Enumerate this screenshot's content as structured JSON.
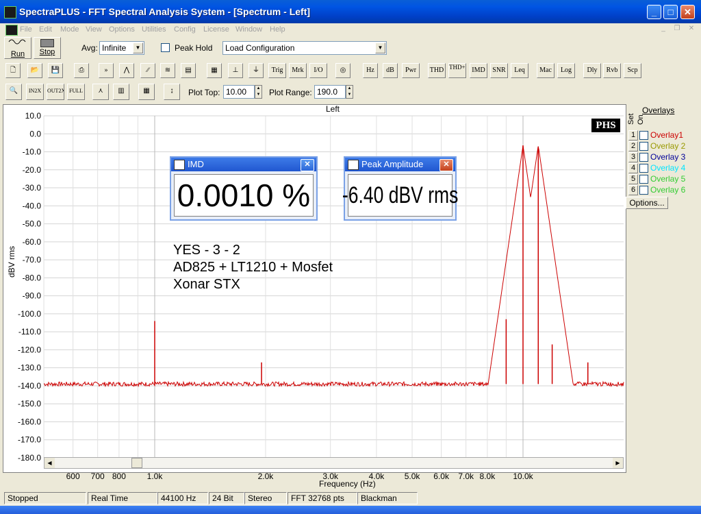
{
  "window": {
    "title": "SpectraPLUS - FFT Spectral Analysis System - [Spectrum - Left]"
  },
  "menu": [
    "File",
    "Edit",
    "Mode",
    "View",
    "Options",
    "Utilities",
    "Config",
    "License",
    "Window",
    "Help"
  ],
  "toolbar1": {
    "run": "Run",
    "stop": "Stop",
    "avg_label": "Avg:",
    "avg_value": "Infinite",
    "peak_hold": "Peak Hold",
    "config_value": "Load Configuration"
  },
  "toolbar2": [
    "Trig",
    "Mrk",
    "I/O",
    "Hz",
    "dB",
    "Pwr",
    "THD",
    "THD+N",
    "IMD",
    "SNR",
    "Leq",
    "Mac",
    "Log",
    "Dly",
    "Rvb",
    "Scp"
  ],
  "toolbar3": {
    "plot_top_label": "Plot Top:",
    "plot_top": "10.00",
    "plot_range_label": "Plot Range:",
    "plot_range": "190.0"
  },
  "plot": {
    "channel": "Left",
    "logo": "PHS",
    "ylabel": "dBV rms",
    "xlabel": "Frequency (Hz)",
    "annotation": [
      "YES - 3 - 2",
      "AD825 + LT1210 + Mosfet",
      "Xonar STX"
    ]
  },
  "chart_data": {
    "type": "line",
    "title": "Left",
    "xlabel": "Frequency (Hz)",
    "ylabel": "dBV rms",
    "x_scale": "log",
    "xlim": [
      500,
      20000
    ],
    "ylim": [
      -180,
      10
    ],
    "x_ticks": [
      "600",
      "700",
      "800",
      "1.0k",
      "2.0k",
      "3.0k",
      "4.0k",
      "5.0k",
      "6.0k",
      "7.0k",
      "8.0k",
      "10.0k"
    ],
    "y_ticks": [
      "10.0",
      "0.0",
      "-10.0",
      "-20.0",
      "-30.0",
      "-40.0",
      "-50.0",
      "-60.0",
      "-70.0",
      "-80.0",
      "-90.0",
      "-100.0",
      "-110.0",
      "-120.0",
      "-130.0",
      "-140.0",
      "-150.0",
      "-160.0",
      "-170.0",
      "-180.0"
    ],
    "grid": true,
    "series_color": "#cc0000",
    "noise_floor_db": -139,
    "peaks": [
      {
        "x": 1000,
        "y": -104
      },
      {
        "x": 1950,
        "y": -127
      },
      {
        "x": 9000,
        "y": -103
      },
      {
        "x": 10000,
        "y": -6.4
      },
      {
        "x": 11000,
        "y": -7
      },
      {
        "x": 12000,
        "y": -117
      },
      {
        "x": 15000,
        "y": -127
      }
    ]
  },
  "meters": {
    "imd": {
      "title": "IMD",
      "value": "0.0010 %"
    },
    "peak": {
      "title": "Peak Amplitude",
      "value": "-6.40 dBV rms"
    }
  },
  "overlays": {
    "header": "Overlays",
    "col_set": "Set",
    "col_on": "On",
    "items": [
      {
        "num": "1",
        "label": "Overlay1",
        "color": "#cc0000"
      },
      {
        "num": "2",
        "label": "Overlay 2",
        "color": "#999900"
      },
      {
        "num": "3",
        "label": "Overlay 3",
        "color": "#000099"
      },
      {
        "num": "4",
        "label": "Overlay 4",
        "color": "#00e5ff"
      },
      {
        "num": "5",
        "label": "Overlay 5",
        "color": "#33cc33"
      },
      {
        "num": "6",
        "label": "Overlay 6",
        "color": "#33cc33"
      }
    ],
    "options": "Options..."
  },
  "status": [
    "Stopped",
    "Real Time",
    "44100 Hz",
    "24 Bit",
    "Stereo",
    "FFT 32768 pts",
    "Blackman"
  ]
}
